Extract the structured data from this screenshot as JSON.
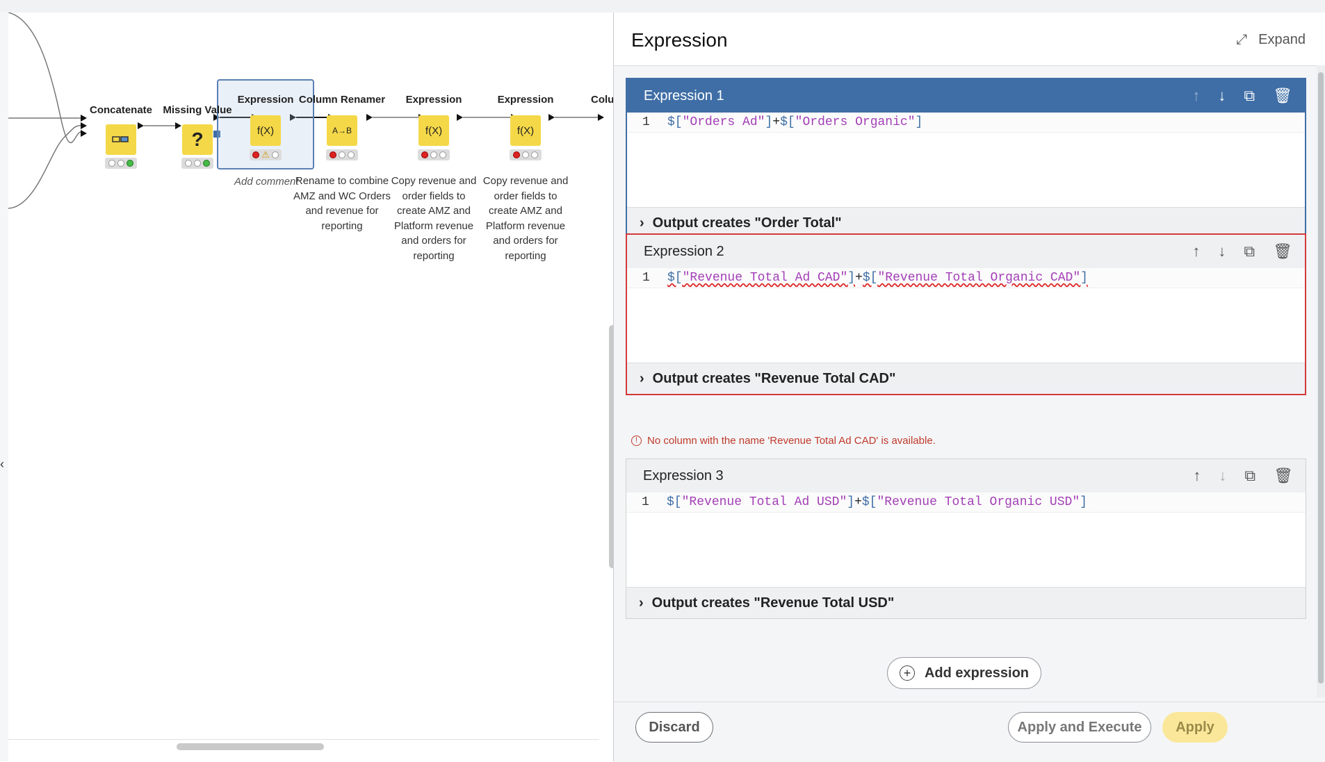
{
  "workflow": {
    "nodes": [
      {
        "title": "Concatenate",
        "icon": "concatenate-icon",
        "status": [
          "off",
          "off",
          "green"
        ]
      },
      {
        "title": "Missing Value",
        "icon": "question-mark-icon",
        "glyph": "?",
        "status": [
          "off",
          "off",
          "green"
        ]
      },
      {
        "title": "Expression",
        "icon": "function-icon",
        "glyph": "f(X)",
        "status": [
          "red",
          "warning",
          "off"
        ],
        "comment": "Add comment"
      },
      {
        "title": "Column Renamer",
        "icon": "column-renamer-icon",
        "glyph": "A→B",
        "status": [
          "red",
          "off",
          "off"
        ],
        "comment": "Rename to combine\nAMZ and WC Orders\nand revenue for\nreporting"
      },
      {
        "title": "Expression",
        "icon": "function-icon",
        "glyph": "f(X)",
        "status": [
          "red",
          "off",
          "off"
        ],
        "comment": "Copy revenue and\norder fields to\ncreate AMZ and\nPlatform revenue\nand orders for\nreporting"
      },
      {
        "title": "Expression",
        "icon": "function-icon",
        "glyph": "f(X)",
        "status": [
          "red",
          "off",
          "off"
        ],
        "comment": "Copy revenue and\norder fields to\ncreate AMZ and\nPlatform revenue\nand orders for\nreporting"
      },
      {
        "title": "Colu"
      }
    ]
  },
  "panel": {
    "title": "Expression",
    "expand_label": "Expand",
    "expressions": [
      {
        "label": "Expression 1",
        "line_no": "1",
        "code_dollar1": "$[",
        "code_str1": "\"Orders Ad\"",
        "code_close1": "]",
        "code_plus": "+",
        "code_dollar2": "$[",
        "code_str2": "\"Orders Organic\"",
        "code_close2": "]",
        "output": "Output creates \"Order Total\""
      },
      {
        "label": "Expression 2",
        "line_no": "1",
        "code_dollar1": "$[",
        "code_str1": "\"Revenue Total Ad CAD\"",
        "code_close1": "]",
        "code_plus": "+",
        "code_dollar2": "$[",
        "code_str2": "\"Revenue Total Organic CAD\"",
        "code_close2": "]",
        "output": "Output creates \"Revenue Total CAD\"",
        "error": "No column with the name 'Revenue Total Ad CAD' is available."
      },
      {
        "label": "Expression 3",
        "line_no": "1",
        "code_dollar1": "$[",
        "code_str1": "\"Revenue Total Ad USD\"",
        "code_close1": "]",
        "code_plus": "+",
        "code_dollar2": "$[",
        "code_str2": "\"Revenue Total Organic USD\"",
        "code_close2": "]",
        "output": "Output creates \"Revenue Total USD\""
      }
    ],
    "add_expression_label": "Add expression",
    "footer": {
      "discard_label": "Discard",
      "apply_execute_label": "Apply and Execute",
      "apply_label": "Apply"
    }
  },
  "colors": {
    "active_header": "#3e6ea5",
    "error_border": "#d23a3a",
    "node_yellow": "#f5d848",
    "apply_button": "#fbe79a"
  }
}
